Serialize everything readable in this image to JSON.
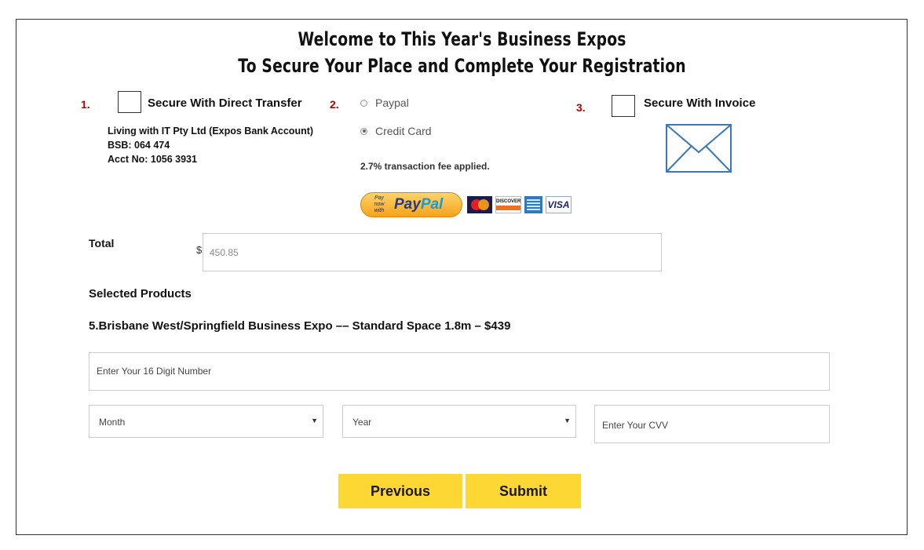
{
  "header": {
    "title_line1": "Welcome to This Year's Business Expos",
    "title_line2": "To Secure Your Place and Complete Your Registration"
  },
  "option1": {
    "number": "1.",
    "label": "Secure With Direct Transfer",
    "bank_lines": [
      "Living with IT Pty Ltd (Expos Bank Account)",
      "BSB: 064 474",
      "Acct No: 1056 3931"
    ]
  },
  "option2": {
    "number": "2.",
    "radio_paypal": "Paypal",
    "radio_credit": "Credit Card",
    "selected": "Credit Card",
    "fee_note": "2.7% transaction fee applied.",
    "paypal_button": {
      "small": "Pay now with",
      "logo_part1": "Pay",
      "logo_part2": "Pal"
    },
    "card_logos": {
      "mastercard": "mastercard-logo",
      "discover": "DISCOVER",
      "amex": "amex-logo",
      "visa": "VISA"
    }
  },
  "option3": {
    "number": "3.",
    "label": "Secure With Invoice",
    "icon": "envelope-icon"
  },
  "total": {
    "label": "Total",
    "currency": "$",
    "value": "450.85"
  },
  "products": {
    "title": "Selected Products",
    "item": "5.Brisbane West/Springfield Business Expo –– Standard Space 1.8m – $439"
  },
  "payment_fields": {
    "card_number_placeholder": "Enter Your 16 Digit Number",
    "month": "Month",
    "year": "Year",
    "cvv_placeholder": "Enter Your CVV"
  },
  "buttons": {
    "previous": "Previous",
    "submit": "Submit"
  },
  "colors": {
    "accent_yellow": "#fdd835",
    "number_red": "#b30000",
    "envelope_blue": "#3b78b8"
  }
}
